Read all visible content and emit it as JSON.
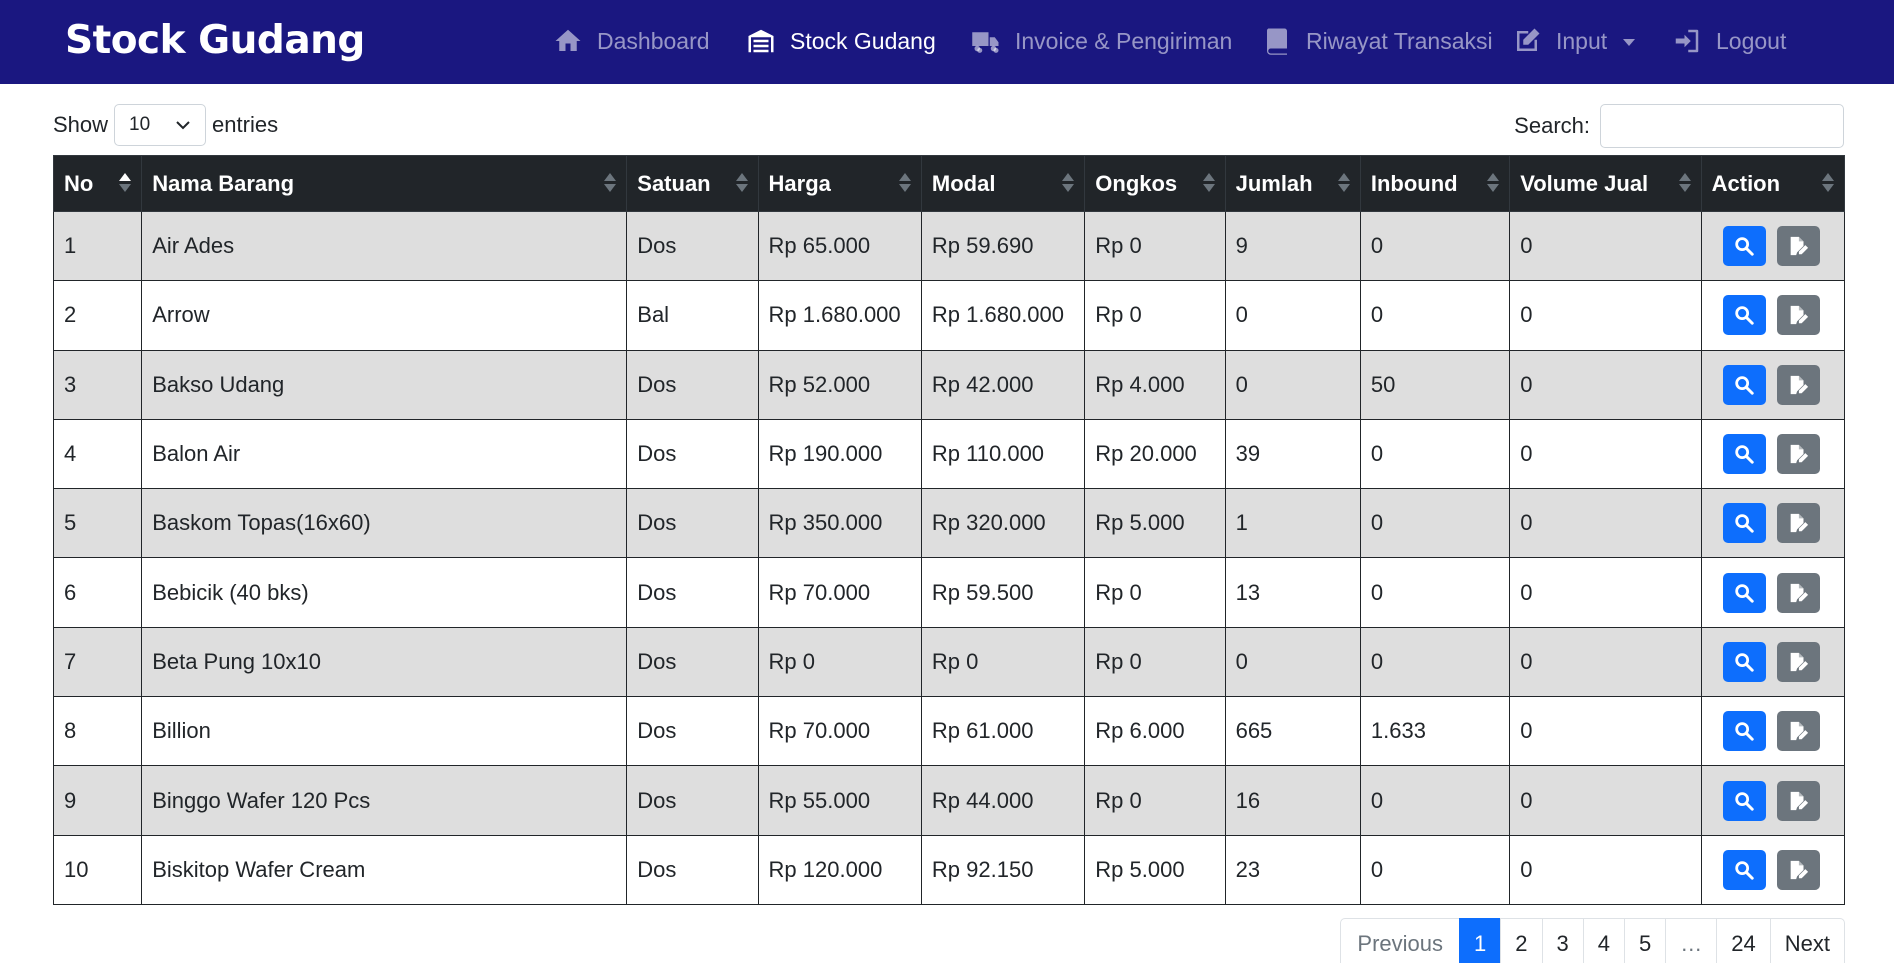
{
  "brand": "Stock Gudang",
  "nav": [
    {
      "label": "Dashboard",
      "icon": "home-icon",
      "active": false
    },
    {
      "label": "Stock Gudang",
      "icon": "warehouse-icon",
      "active": true
    },
    {
      "label": "Invoice & Pengiriman",
      "icon": "truck-icon",
      "active": false
    },
    {
      "label": "Riwayat Transaksi",
      "icon": "book-icon",
      "active": false
    },
    {
      "label": "Input",
      "icon": "edit-icon",
      "active": false
    },
    {
      "label": "Logout",
      "icon": "logout-icon",
      "active": false
    }
  ],
  "length": {
    "show": "Show",
    "value": "10",
    "entries": "entries"
  },
  "search": {
    "label": "Search:",
    "value": ""
  },
  "table": {
    "columns": [
      "No",
      "Nama Barang",
      "Satuan",
      "Harga",
      "Modal",
      "Ongkos",
      "Jumlah",
      "Inbound",
      "Volume Jual",
      "Action"
    ],
    "rows": [
      [
        "1",
        "Air Ades",
        "Dos",
        "Rp 65.000",
        "Rp 59.690",
        "Rp 0",
        "9",
        "0",
        "0"
      ],
      [
        "2",
        "Arrow",
        "Bal",
        "Rp 1.680.000",
        "Rp 1.680.000",
        "Rp 0",
        "0",
        "0",
        "0"
      ],
      [
        "3",
        "Bakso Udang",
        "Dos",
        "Rp 52.000",
        "Rp 42.000",
        "Rp 4.000",
        "0",
        "50",
        "0"
      ],
      [
        "4",
        "Balon Air",
        "Dos",
        "Rp 190.000",
        "Rp 110.000",
        "Rp 20.000",
        "39",
        "0",
        "0"
      ],
      [
        "5",
        "Baskom Topas(16x60)",
        "Dos",
        "Rp 350.000",
        "Rp 320.000",
        "Rp 5.000",
        "1",
        "0",
        "0"
      ],
      [
        "6",
        "Bebicik (40 bks)",
        "Dos",
        "Rp 70.000",
        "Rp 59.500",
        "Rp 0",
        "13",
        "0",
        "0"
      ],
      [
        "7",
        "Beta Pung 10x10",
        "Dos",
        "Rp 0",
        "Rp 0",
        "Rp 0",
        "0",
        "0",
        "0"
      ],
      [
        "8",
        "Billion",
        "Dos",
        "Rp 70.000",
        "Rp 61.000",
        "Rp 6.000",
        "665",
        "1.633",
        "0"
      ],
      [
        "9",
        "Binggo Wafer 120 Pcs",
        "Dos",
        "Rp 55.000",
        "Rp 44.000",
        "Rp 0",
        "16",
        "0",
        "0"
      ],
      [
        "10",
        "Biskitop Wafer Cream",
        "Dos",
        "Rp 120.000",
        "Rp 92.150",
        "Rp 5.000",
        "23",
        "0",
        "0"
      ]
    ]
  },
  "pagination": {
    "previous": "Previous",
    "pages": [
      "1",
      "2",
      "3",
      "4",
      "5",
      "…",
      "24"
    ],
    "active": "1",
    "next": "Next"
  },
  "colors": {
    "navbar": "#1a1780",
    "header": "#212529",
    "primary": "#0d6efd",
    "secondary": "#6c757d",
    "stripe": "#dedede"
  }
}
